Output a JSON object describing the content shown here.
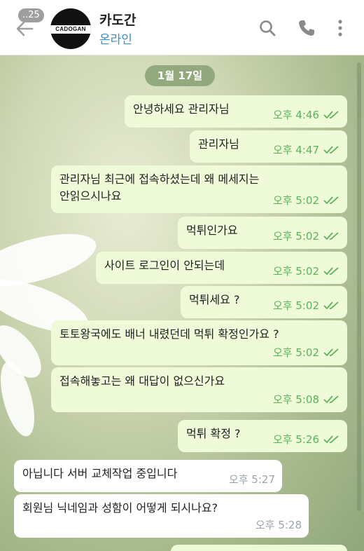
{
  "header": {
    "unread_count": "..25",
    "chat_name": "카도간",
    "status": "온라인",
    "avatar_text": "CADOGAN"
  },
  "chat": {
    "date_label": "1월 17일",
    "messages": [
      {
        "type": "out",
        "text": "안녕하세요 관리자님",
        "time": "오후 4:46"
      },
      {
        "type": "out",
        "text": "관리자님",
        "time": "오후 4:47"
      },
      {
        "type": "out",
        "text": "관리자님 최근에 접속하셨는데 왜 메세지는\n안읽으시나요",
        "time": "오후 5:02"
      },
      {
        "type": "out",
        "text": "먹튀인가요",
        "time": "오후 5:02"
      },
      {
        "type": "out",
        "text": "사이트 로그인이 안되는데",
        "time": "오후 5:02"
      },
      {
        "type": "out",
        "text": "먹튀세요 ?",
        "time": "오후 5:02"
      },
      {
        "type": "out",
        "text": "토토왕국에도 배너 내렸던데 먹튀 확정인가요 ?",
        "time": "오후 5:02"
      },
      {
        "type": "out",
        "text": "접속해놓고는 왜 대답이 없으신가요",
        "time": "오후 5:08"
      },
      {
        "type": "out",
        "text": "먹튀 확정 ?",
        "time": "오후 5:26"
      },
      {
        "type": "in",
        "text": "아닙니다 서버 교체작업 중입니다",
        "time": "오후 5:27"
      },
      {
        "type": "in",
        "text": "회원님 닉네임과 성함이 어떻게 되시나요?",
        "time": "오후 5:28"
      }
    ]
  },
  "colors": {
    "outgoing_bubble": "#eefad8",
    "incoming_bubble": "#ffffff",
    "time_outgoing": "#5cb25c",
    "status_online": "#3a8fd0"
  },
  "icons": [
    "back-arrow-icon",
    "search-icon",
    "phone-icon",
    "more-vertical-icon",
    "double-check-icon"
  ]
}
